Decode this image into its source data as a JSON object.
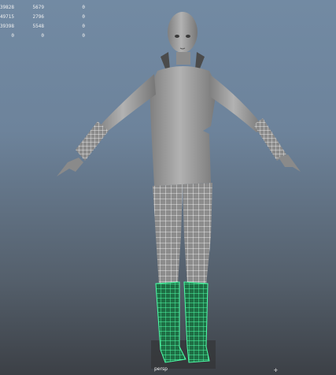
{
  "hud": {
    "rows": [
      [
        "39828",
        "5679",
        "0"
      ],
      [
        "49715",
        "2796",
        "0"
      ],
      [
        "39398",
        "5548",
        "0"
      ],
      [
        "0",
        "0",
        "0"
      ]
    ]
  },
  "camera": {
    "label": "persp"
  },
  "axis_icon": "axis-gizmo-icon",
  "colors": {
    "wire_white": "#ffffff",
    "wire_selected": "#38ff9a",
    "body": "#9a9a9a"
  }
}
